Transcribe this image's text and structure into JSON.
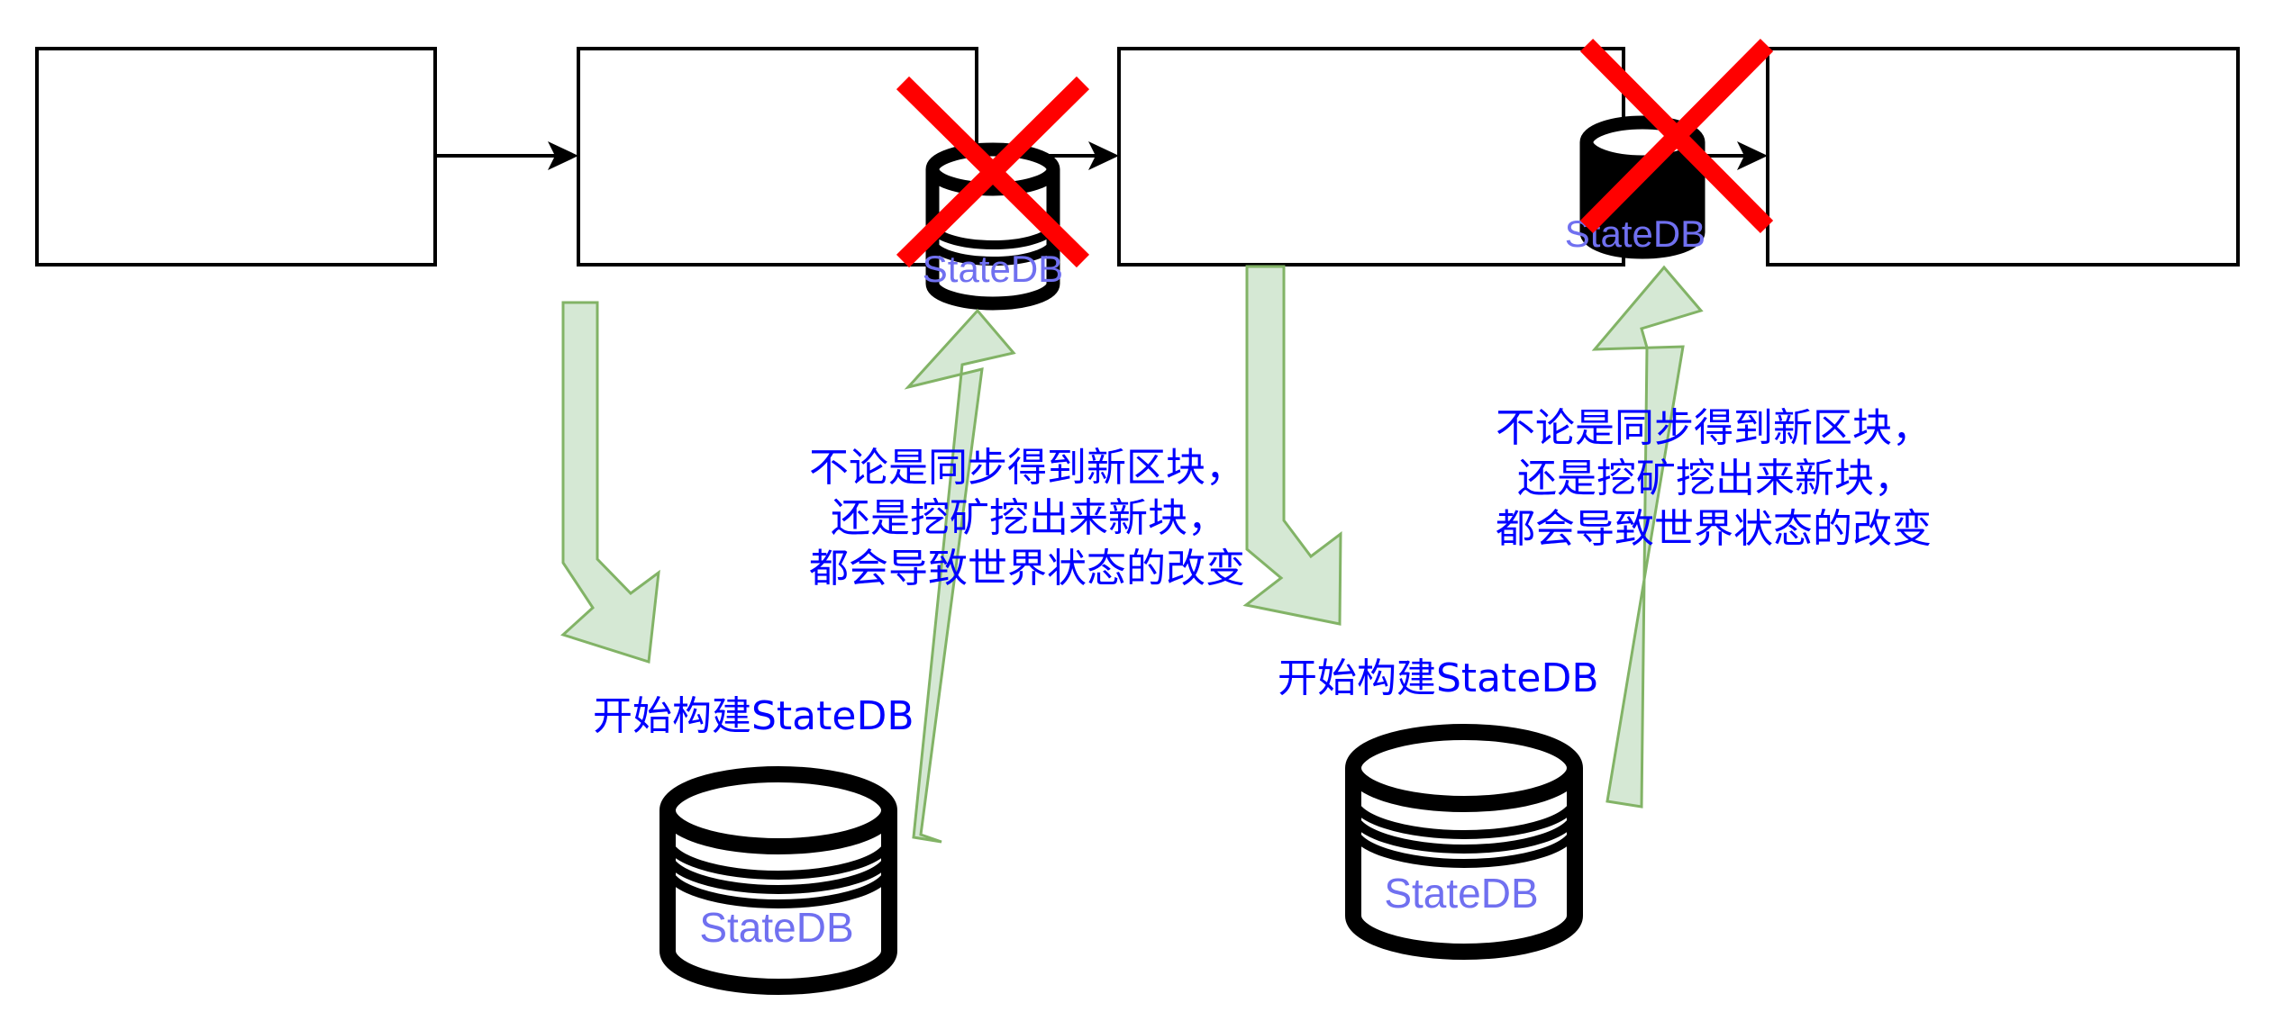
{
  "colors": {
    "block_stroke": "#000000",
    "arrow_fill": "#D5E8D4",
    "arrow_stroke": "#82B366",
    "cross": "#FF0000",
    "text_blue": "#0000FF",
    "db_label": "#7070F0"
  },
  "icons": [
    "database-icon",
    "cross-icon",
    "arrow-icon"
  ],
  "labels": {
    "start_build": "开始构建StateDB",
    "note_line_1": "不论是同步得到新区块，",
    "note_line_2": "还是挖矿挖出来新块，",
    "note_line_3": "都会导致世界状态的改变",
    "statedb": "StateDB"
  }
}
